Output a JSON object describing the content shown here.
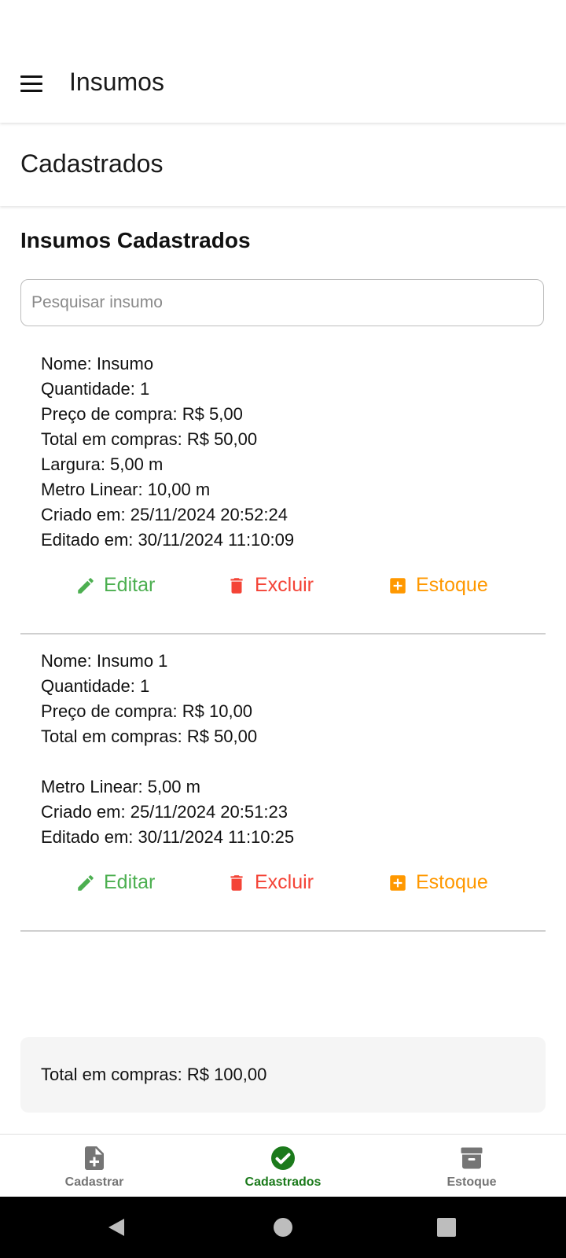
{
  "app": {
    "title": "Insumos"
  },
  "section": {
    "title": "Cadastrados"
  },
  "list": {
    "heading": "Insumos Cadastrados",
    "search_placeholder": "Pesquisar insumo",
    "items": [
      {
        "lines": [
          "Nome: Insumo",
          "Quantidade: 1",
          "Preço de compra: R$ 5,00",
          "Total em compras: R$ 50,00",
          "Largura: 5,00 m",
          "Metro Linear: 10,00 m",
          "Criado em: 25/11/2024 20:52:24",
          "Editado em: 30/11/2024 11:10:09"
        ]
      },
      {
        "lines": [
          "Nome: Insumo 1",
          "Quantidade: 1",
          "Preço de compra: R$ 10,00",
          "Total em compras: R$ 50,00",
          "",
          "Metro Linear: 5,00 m",
          "Criado em: 25/11/2024 20:51:23",
          "Editado em: 30/11/2024 11:10:25"
        ]
      }
    ],
    "actions": {
      "edit_label": "Editar",
      "delete_label": "Excluir",
      "stock_label": "Estoque"
    }
  },
  "summary": {
    "total_text": "Total em compras: R$ 100,00"
  },
  "bottom_nav": {
    "items": [
      {
        "label": "Cadastrar",
        "icon": "file-add-icon",
        "active": false
      },
      {
        "label": "Cadastrados",
        "icon": "check-circle-icon",
        "active": true
      },
      {
        "label": "Estoque",
        "icon": "archive-icon",
        "active": false
      }
    ]
  },
  "colors": {
    "edit": "#4caf50",
    "delete": "#f44336",
    "stock": "#ff9800",
    "nav_active": "#1b7a1b",
    "nav_inactive": "#757575"
  }
}
